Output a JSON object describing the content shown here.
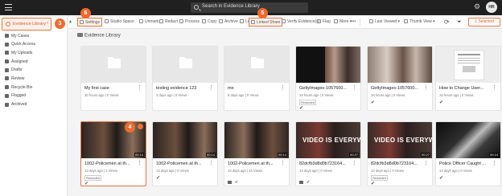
{
  "topbar": {
    "search_placeholder": "Search in Evidence Library",
    "avatar_initials": "HR"
  },
  "sidebar": {
    "header_label": "Evidence Library",
    "items": [
      {
        "label": "My Cases"
      },
      {
        "label": "Quick Access"
      },
      {
        "label": "My Uploads"
      },
      {
        "label": "Assigned"
      },
      {
        "label": "Drafts"
      },
      {
        "label": "Review"
      },
      {
        "label": "Recycle Bin"
      },
      {
        "label": "Flagged"
      },
      {
        "label": "Archived"
      }
    ]
  },
  "callouts": {
    "c3": "3",
    "c4": "4",
    "c5": "5",
    "c6": "6"
  },
  "toolbar": {
    "settings": "Settings",
    "studio_space": "Studio Space",
    "unmark": "Unmark",
    "redact": "Redact",
    "process": "Process",
    "copy": "Copy",
    "archive": "Archive",
    "lock": "Lock",
    "linked_share": "Linked Share",
    "verify": "Verify Evidence(s)",
    "flag": "Flag",
    "more": "More",
    "sort": "Last Viewed",
    "view": "Thumb View",
    "selected": "1 Selected"
  },
  "breadcrumb": "Evidence Library",
  "cards": [
    {
      "title": "My first case",
      "meta": "30 hours ago | 0 Views",
      "type": "folder"
    },
    {
      "title": "testing evidence 123",
      "meta": "3 days ago | 0 Views",
      "type": "folder"
    },
    {
      "title": "me",
      "meta": "5 days ago | 0 Views",
      "type": "folder"
    },
    {
      "title": "GettyImages-1057600...",
      "meta": "19 hours ago | 0 Views",
      "type": "image",
      "badge": "Redacted"
    },
    {
      "title": "GettyImages-1057600...",
      "meta": "19 hours ago | 0 Views",
      "type": "image"
    },
    {
      "title": "How to Change User...",
      "meta": "19 hours ago | 0 Views",
      "type": "doc"
    },
    {
      "title": "1002-Policemen at th...",
      "meta": "13 days ago | 2 Views",
      "type": "video",
      "duration": "00:14",
      "badge": "Redacted"
    },
    {
      "title": "1002-Policemen at th...",
      "meta": "13 days ago | 0 Views",
      "type": "video",
      "duration": "00:14"
    },
    {
      "title": "1002-Policemen at th...",
      "meta": "13 days ago | 15 Views",
      "type": "video",
      "duration": "00:14"
    },
    {
      "title": "82dcfb3d8d0b723164...",
      "meta": "13 days ago | 0 Views",
      "type": "video",
      "duration": "00:27",
      "overlay": "VIDEO IS EVERYWHE"
    },
    {
      "title": "82dcfb3d8d0b723164...",
      "meta": "13 days ago | 0 Views",
      "type": "video",
      "duration": "00:27",
      "overlay": "VIDEO IS EVERYWHE",
      "badge": "Redacted"
    },
    {
      "title": "Police Officer Caught ...",
      "meta": "13 days ago | 0 Views",
      "type": "video",
      "duration": "00:14"
    }
  ],
  "colors": {
    "accent": "#e8743b",
    "topbar": "#202020"
  }
}
